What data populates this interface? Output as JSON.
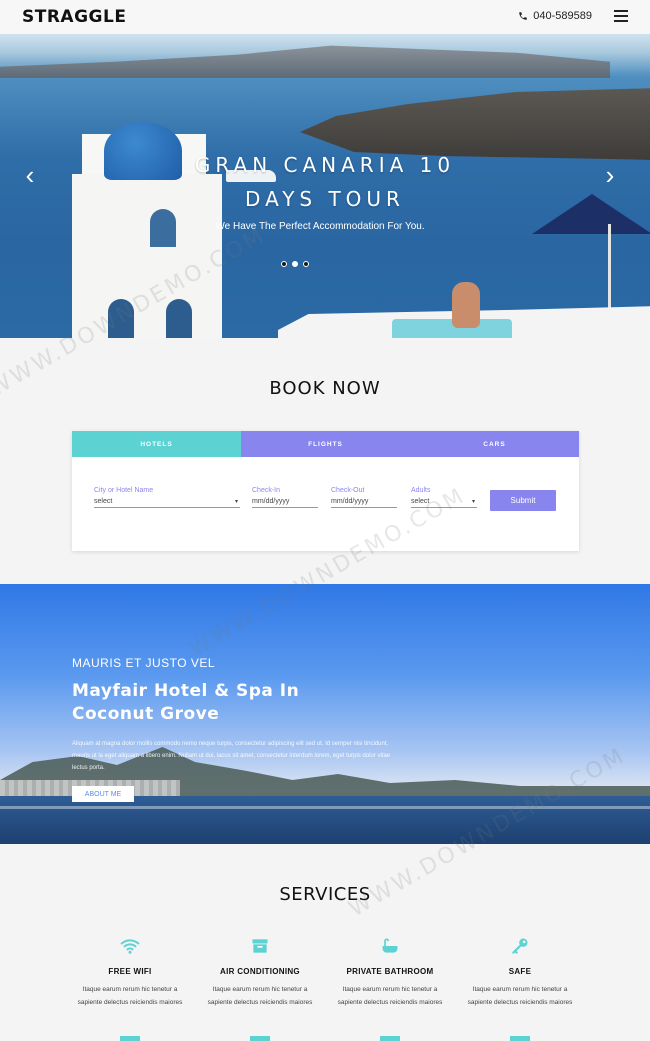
{
  "header": {
    "logo": "STRAGGLE",
    "phone": "040-589589",
    "phone_icon": "phone-icon",
    "menu_icon": "hamburger-menu-icon"
  },
  "hero": {
    "title_line1": "GRAN CANARIA 10",
    "title_line2": "DAYS TOUR",
    "subtitle": "We Have The Perfect Accommodation For You.",
    "prev": "‹",
    "next": "›",
    "slides": 3,
    "active_slide": 2
  },
  "booking": {
    "title": "BOOK NOW",
    "tabs": [
      "HOTELS",
      "FLIGHTS",
      "CARS"
    ],
    "active_tab": "HOTELS",
    "fields": {
      "city": {
        "label": "City or Hotel Name",
        "value": "select"
      },
      "checkin": {
        "label": "Check-In",
        "placeholder": "mm/dd/yyyy"
      },
      "checkout": {
        "label": "Check-Out",
        "placeholder": "mm/dd/yyyy"
      },
      "adults": {
        "label": "Adults",
        "value": "select"
      }
    },
    "submit": "Submit"
  },
  "feature": {
    "kicker": "MAURIS ET JUSTO VEL",
    "title": "Mayfair Hotel & Spa In Coconut Grove",
    "text": "Aliquam at magna dolor mollis commodo nemo neque turpis, consectetur adipiscing elit sed ut. Id semper nisi tincidunt, mauris ut la eget aliquam a libero enim. Nullam ut dui, lacus sit amet, consectetur interdum lorem, eget turpis dolor vitae lectus porta.",
    "button": "ABOUT ME"
  },
  "services": {
    "title": "SERVICES",
    "items": [
      {
        "name": "FREE WIFI",
        "icon": "wifi-icon",
        "desc": "Itaque earum rerum hic tenetur a sapiente delectus reiciendis maiores"
      },
      {
        "name": "AIR CONDITIONING",
        "icon": "air-conditioning-icon",
        "desc": "Itaque earum rerum hic tenetur a sapiente delectus reiciendis maiores"
      },
      {
        "name": "PRIVATE BATHROOM",
        "icon": "bathtub-icon",
        "desc": "Itaque earum rerum hic tenetur a sapiente delectus reiciendis maiores"
      },
      {
        "name": "SAFE",
        "icon": "key-icon",
        "desc": "Itaque earum rerum hic tenetur a sapiente delectus reiciendis maiores"
      }
    ]
  },
  "watermark": "WWW.DOWNDEMO.COM",
  "colors": {
    "accent_teal": "#5cd3d2",
    "accent_purple": "#8985ee"
  }
}
